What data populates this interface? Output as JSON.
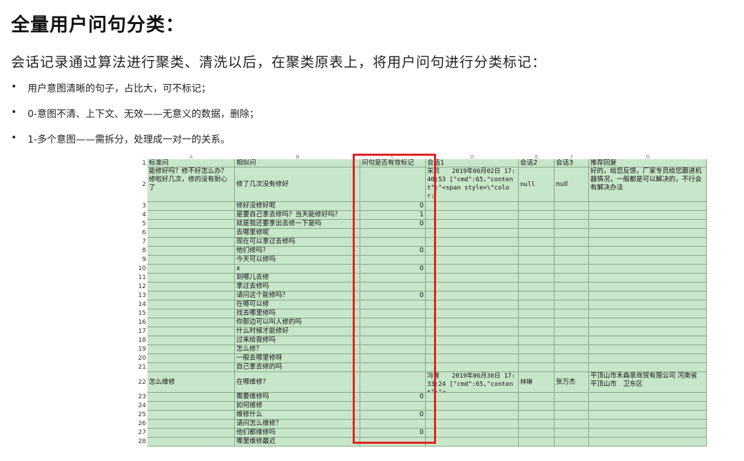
{
  "page": {
    "title": "全量用户问句分类：",
    "subtitle": "会话记录通过算法进行聚类、清洗以后，在聚类原表上，将用户问句进行分类标记：",
    "bullets": [
      "用户意图清晰的句子，占比大，可不标记；",
      "0-意图不清、上下文、无效——无意义的数据，删除；",
      "1-多个意图——需拆分，处理成一对一的关系。"
    ],
    "bullet_glyph": "•"
  },
  "sheet": {
    "column_letters": [
      "A",
      "B",
      "C",
      "D",
      "E",
      "F",
      "G"
    ],
    "header": [
      "标准问",
      "相似问",
      "问句是否有效标记",
      "会话1",
      "会话2",
      "会话3",
      "推荐回复"
    ],
    "row_numbers": [
      "1",
      "2",
      "3",
      "4",
      "5",
      "6",
      "7",
      "8",
      "9",
      "10",
      "11",
      "12",
      "13",
      "14",
      "15",
      "16",
      "17",
      "18",
      "19",
      "20",
      "21",
      "22",
      "23",
      "24",
      "25",
      "26",
      "27",
      "28"
    ],
    "rows": [
      {
        "std": "能修好吗？修不好怎么办？修啦好几次，修的没有耐心了",
        "sim": "修了几次没有修好",
        "flag": "",
        "s1": "宋莉　　2019年06月02日 17:40:53 [\"cmd\":65,\"content\":\"<span style=\\\"color:",
        "s2": "null",
        "s3": "null",
        "reply": "好的，给您反馈，厂家专员给您跟进机器情况，一般都是可以解决的，不行会有解决办法"
      },
      {
        "std": "",
        "sim": "修好没修好呢",
        "flag": "0"
      },
      {
        "std": "",
        "sim": "是要自己拿去修吗？当天能修好吗？",
        "flag": "1"
      },
      {
        "std": "",
        "sim": "就是我还要拿出去修一下是吗",
        "flag": "0"
      },
      {
        "std": "",
        "sim": "去哪里修呢",
        "flag": ""
      },
      {
        "std": "",
        "sim": "现在可以拿过去修吗",
        "flag": ""
      },
      {
        "std": "",
        "sim": "他们修吗？",
        "flag": "0"
      },
      {
        "std": "",
        "sim": "今天可以修吗",
        "flag": ""
      },
      {
        "std": "",
        "sim": "x",
        "flag": "0"
      },
      {
        "std": "",
        "sim": "到哪儿去修",
        "flag": ""
      },
      {
        "std": "",
        "sim": "拿过去修吗",
        "flag": ""
      },
      {
        "std": "",
        "sim": "请问这个能修吗？",
        "flag": "0"
      },
      {
        "std": "",
        "sim": "在哪可以修",
        "flag": ""
      },
      {
        "std": "",
        "sim": "找去哪里修吗",
        "flag": ""
      },
      {
        "std": "",
        "sim": "你那边可以叫人修的吗",
        "flag": ""
      },
      {
        "std": "",
        "sim": "什么时候才能修好",
        "flag": ""
      },
      {
        "std": "",
        "sim": "过来给我修吗",
        "flag": ""
      },
      {
        "std": "",
        "sim": "怎么修？",
        "flag": ""
      },
      {
        "std": "",
        "sim": "一般去哪里修呀",
        "flag": ""
      },
      {
        "std": "",
        "sim": "自己拿去修的吗",
        "flag": ""
      },
      {
        "std": "怎么维修",
        "sim": "在哪维修？",
        "flag": "",
        "s1": "冯雪　　2019年06月30日 17:33:24 [\"cmd\":65,\"content\":\"<",
        "s2": "林琳",
        "s3": "张万杰",
        "reply": "平顶山市禾森泉商贸有限公司 河南省　平顶山市　卫东区"
      },
      {
        "std": "",
        "sim": "需要维修吗",
        "flag": "0"
      },
      {
        "std": "",
        "sim": "如何维修",
        "flag": ""
      },
      {
        "std": "",
        "sim": "维修什么",
        "flag": "0"
      },
      {
        "std": "",
        "sim": "请问怎么维修？",
        "flag": ""
      },
      {
        "std": "",
        "sim": "他们都维修吗",
        "flag": "0"
      },
      {
        "std": "",
        "sim": "哪里维修最近",
        "flag": ""
      }
    ]
  },
  "colors": {
    "cell_bg": "#c8e6c9",
    "grid_line": "#8aa48b",
    "highlight_box": "#e02020"
  }
}
